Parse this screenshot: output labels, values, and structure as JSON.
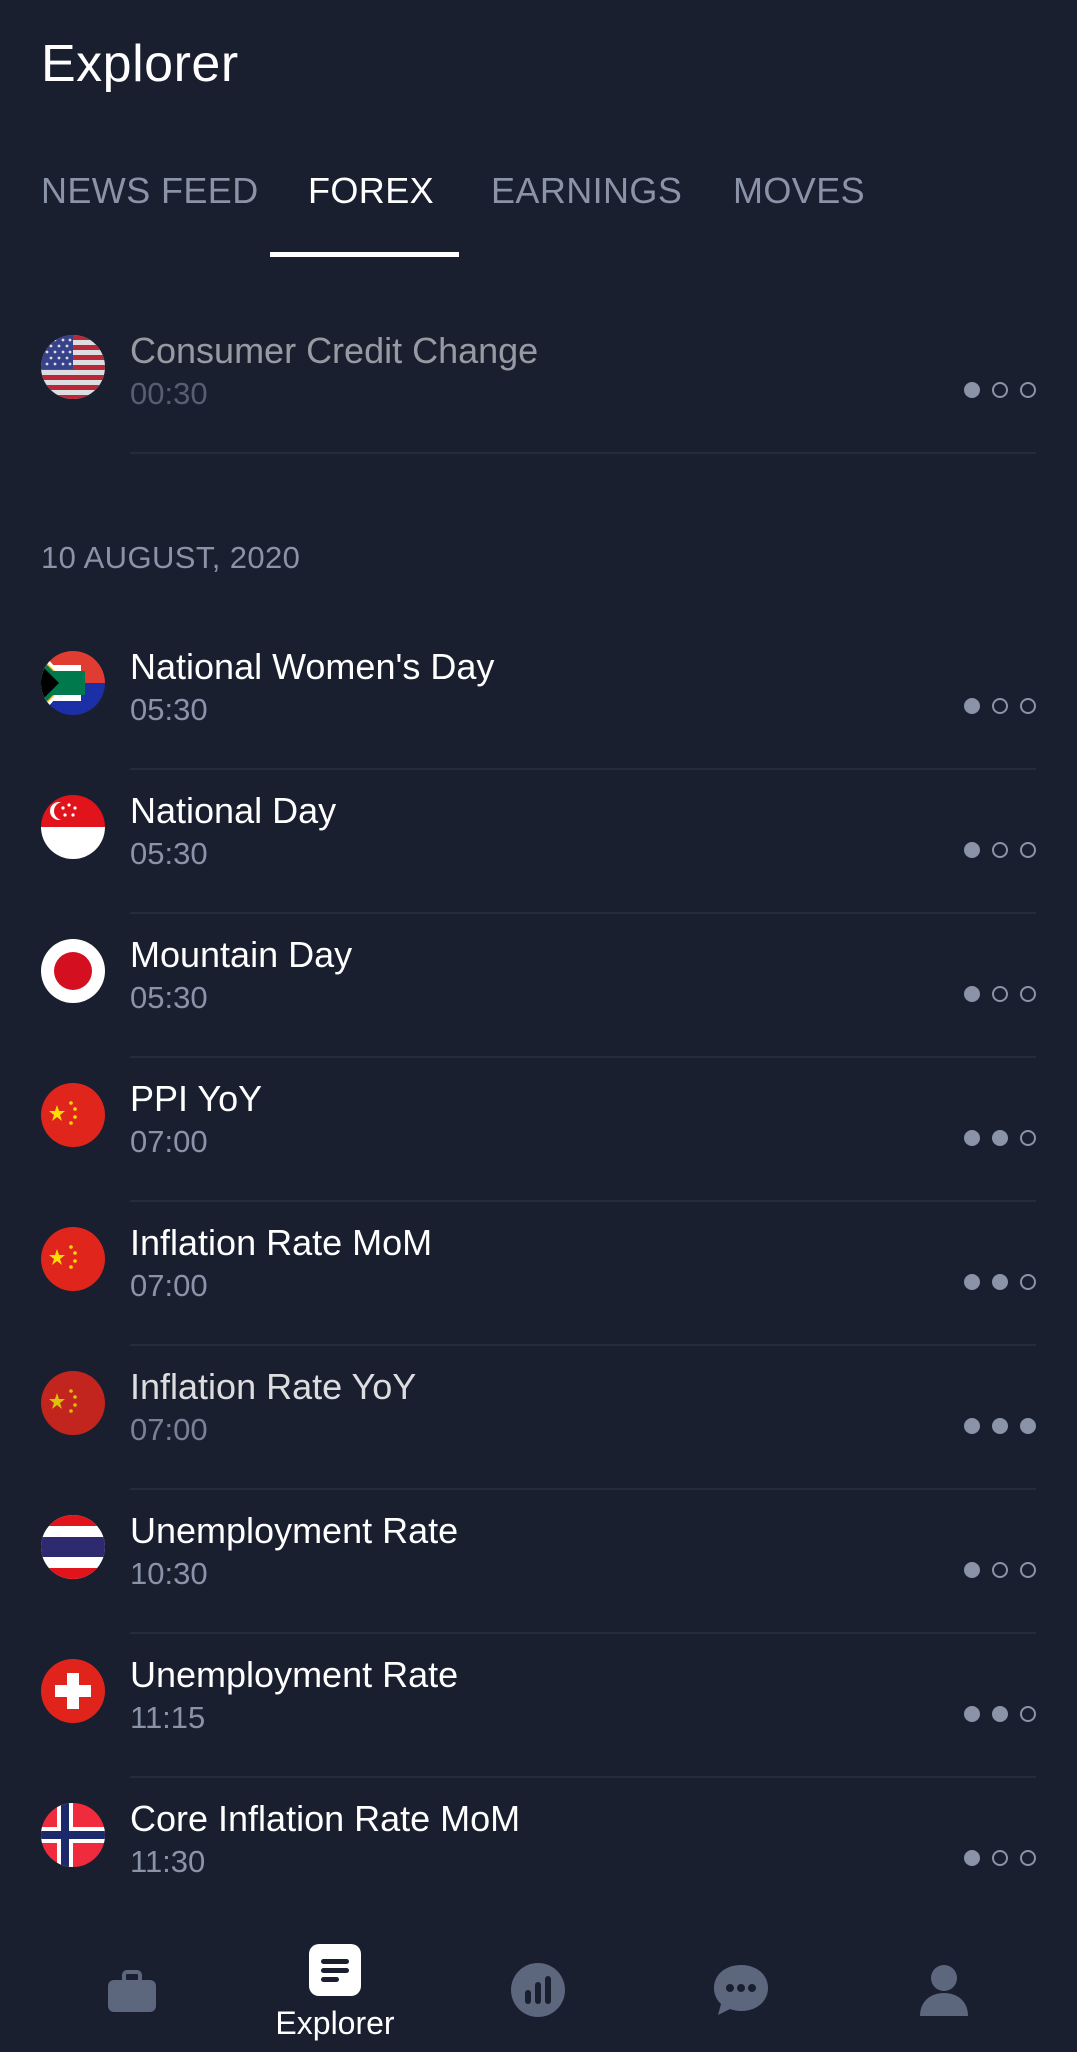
{
  "header": {
    "title": "Explorer"
  },
  "tabs": [
    {
      "label": "NEWS FEED"
    },
    {
      "label": "FOREX"
    },
    {
      "label": "EARNINGS"
    },
    {
      "label": "MOVES"
    }
  ],
  "active_tab": "FOREX",
  "events_before": [
    {
      "name": "Consumer Credit Change",
      "time": "00:30",
      "country": "us-flag",
      "importance": 1
    }
  ],
  "date_header": "10 AUGUST, 2020",
  "events": [
    {
      "name": "National Women's Day",
      "time": "05:30",
      "country": "south-africa-flag",
      "importance": 1
    },
    {
      "name": "National Day",
      "time": "05:30",
      "country": "singapore-flag",
      "importance": 1
    },
    {
      "name": "Mountain Day",
      "time": "05:30",
      "country": "japan-flag",
      "importance": 1
    },
    {
      "name": "PPI YoY",
      "time": "07:00",
      "country": "china-flag",
      "importance": 2
    },
    {
      "name": "Inflation Rate MoM",
      "time": "07:00",
      "country": "china-flag",
      "importance": 2
    },
    {
      "name": "Inflation Rate YoY",
      "time": "07:00",
      "country": "china-flag",
      "importance": 3
    },
    {
      "name": "Unemployment Rate",
      "time": "10:30",
      "country": "thailand-flag",
      "importance": 1
    },
    {
      "name": "Unemployment Rate",
      "time": "11:15",
      "country": "switzerland-flag",
      "importance": 2
    },
    {
      "name": "Core Inflation Rate MoM",
      "time": "11:30",
      "country": "norway-flag",
      "importance": 1
    }
  ],
  "bottom_nav": {
    "items": [
      {
        "icon": "briefcase-icon",
        "label": ""
      },
      {
        "icon": "explorer-icon",
        "label": "Explorer"
      },
      {
        "icon": "chart-icon",
        "label": ""
      },
      {
        "icon": "chat-icon",
        "label": ""
      },
      {
        "icon": "profile-icon",
        "label": ""
      }
    ]
  },
  "colors": {
    "background": "#1a1f30",
    "text_primary": "#ffffff",
    "text_secondary": "#8a93a8",
    "divider": "#252b3d"
  }
}
